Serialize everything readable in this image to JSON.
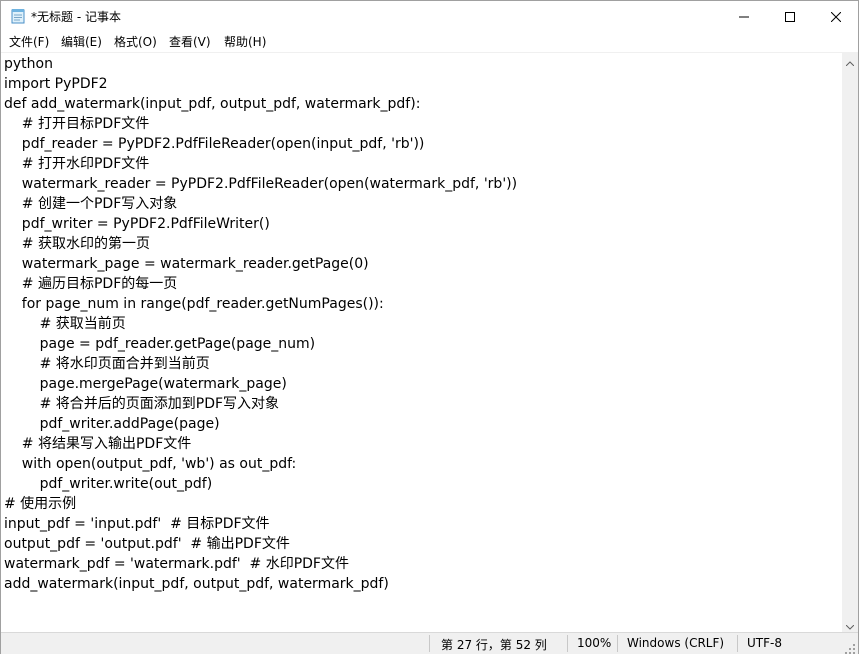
{
  "window": {
    "title": "*无标题 - 记事本"
  },
  "icons": {
    "app": "notepad-icon",
    "minimize": "minimize-icon",
    "maximize": "maximize-icon",
    "close": "close-icon"
  },
  "menu": {
    "file": "文件(F)",
    "edit": "编辑(E)",
    "format": "格式(O)",
    "view": "查看(V)",
    "help": "帮助(H)"
  },
  "editor": {
    "lines": [
      "python",
      "import PyPDF2",
      "def add_watermark(input_pdf, output_pdf, watermark_pdf):",
      "    # 打开目标PDF文件",
      "    pdf_reader = PyPDF2.PdfFileReader(open(input_pdf, 'rb'))",
      "    # 打开水印PDF文件",
      "    watermark_reader = PyPDF2.PdfFileReader(open(watermark_pdf, 'rb'))",
      "    # 创建一个PDF写入对象",
      "    pdf_writer = PyPDF2.PdfFileWriter()",
      "    # 获取水印的第一页",
      "    watermark_page = watermark_reader.getPage(0)",
      "    # 遍历目标PDF的每一页",
      "    for page_num in range(pdf_reader.getNumPages()):",
      "        # 获取当前页",
      "        page = pdf_reader.getPage(page_num)",
      "        # 将水印页面合并到当前页",
      "        page.mergePage(watermark_page)",
      "        # 将合并后的页面添加到PDF写入对象",
      "        pdf_writer.addPage(page)",
      "    # 将结果写入输出PDF文件",
      "    with open(output_pdf, 'wb') as out_pdf:",
      "        pdf_writer.write(out_pdf)",
      "# 使用示例",
      "input_pdf = 'input.pdf'  # 目标PDF文件",
      "output_pdf = 'output.pdf'  # 输出PDF文件",
      "watermark_pdf = 'watermark.pdf'  # 水印PDF文件",
      "add_watermark(input_pdf, output_pdf, watermark_pdf)"
    ]
  },
  "status": {
    "position": "第 27 行，第 52 列",
    "zoom": "100%",
    "line_ending": "Windows (CRLF)",
    "encoding": "UTF-8"
  }
}
